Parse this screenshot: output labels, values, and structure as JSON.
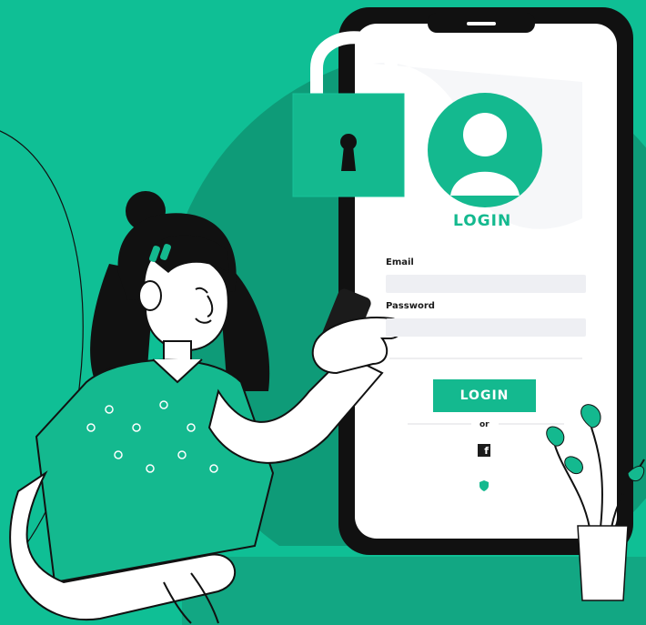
{
  "login_screen": {
    "title": "LOGIN",
    "email_label": "Email",
    "password_label": "Password",
    "email_placeholder": "",
    "password_placeholder": "",
    "button_label": "LOGIN",
    "divider_text": "or",
    "facebook_icon_glyph": "f"
  },
  "colors": {
    "background": "#0fbf95",
    "accent": "#14b98f",
    "dark": "#1b1b1b",
    "white": "#ffffff"
  },
  "icons": [
    "padlock-icon",
    "user-avatar-icon",
    "facebook-icon",
    "shield-icon"
  ]
}
